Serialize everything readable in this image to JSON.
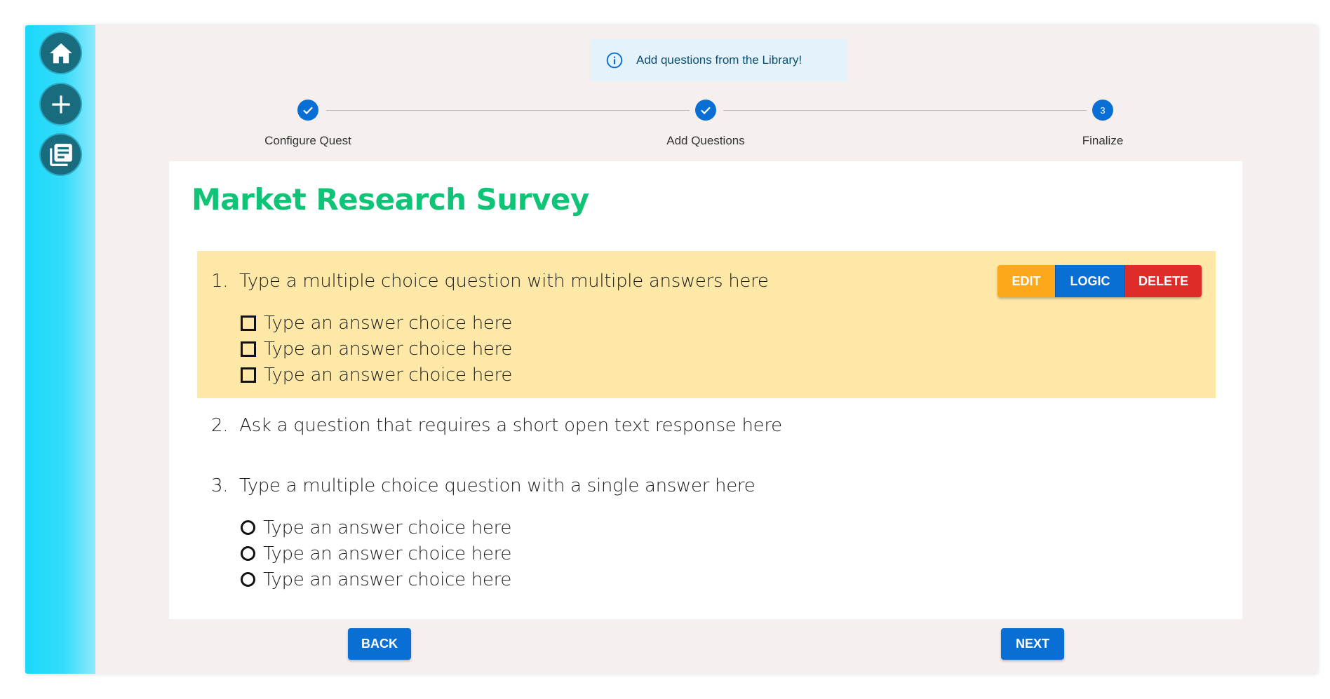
{
  "sidebar": {
    "items": [
      {
        "icon": "home-icon"
      },
      {
        "icon": "plus-icon"
      },
      {
        "icon": "library-icon"
      }
    ]
  },
  "alert": {
    "icon": "info-icon",
    "text": "Add questions from the Library!"
  },
  "stepper": {
    "steps": [
      {
        "label": "Configure Quest",
        "status": "complete"
      },
      {
        "label": "Add Questions",
        "status": "complete"
      },
      {
        "label": "Finalize",
        "status": "active",
        "number": "3"
      }
    ]
  },
  "survey": {
    "title": "Market Research Survey",
    "questions": [
      {
        "number": "1.",
        "text": "Type a multiple choice question with multiple answers here",
        "type": "checkbox",
        "selected": true,
        "choices": [
          "Type an answer choice here",
          "Type an answer choice here",
          "Type an answer choice here"
        ]
      },
      {
        "number": "2.",
        "text": "Ask a question that requires a short open text response here",
        "type": "text"
      },
      {
        "number": "3.",
        "text": "Type a multiple choice question with a single answer here",
        "type": "radio",
        "choices": [
          "Type an answer choice here",
          "Type an answer choice here",
          "Type an answer choice here"
        ]
      }
    ],
    "actions": {
      "edit": "EDIT",
      "logic": "LOGIC",
      "delete": "DELETE"
    }
  },
  "nav": {
    "back": "BACK",
    "next": "NEXT"
  },
  "colors": {
    "title_green": "#0fc477",
    "primary_blue": "#0a6fd4",
    "edit_orange": "#fba91a",
    "delete_red": "#e02b2b",
    "selected_bg": "#fde8a8",
    "sidebar_cyan": "#1ad8fb"
  }
}
